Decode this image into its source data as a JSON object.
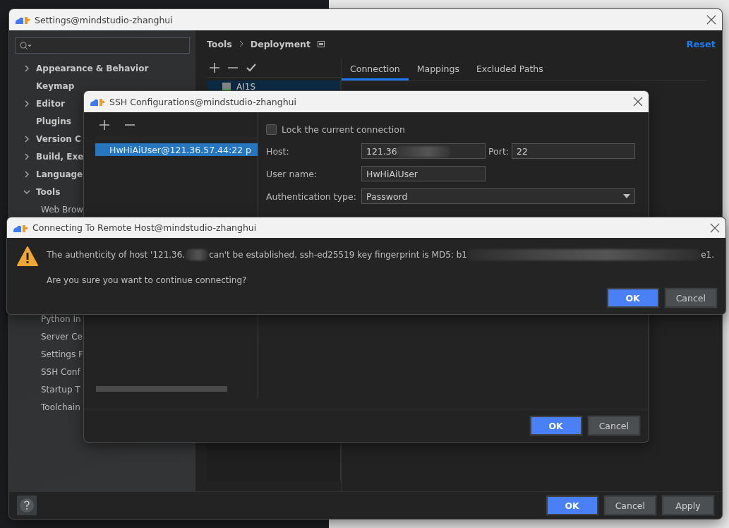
{
  "settings_window": {
    "title": "Settings@mindstudio-zhanghui",
    "sidebar": {
      "items": [
        {
          "label": "Appearance & Behavior",
          "kind": "group",
          "expanded": false
        },
        {
          "label": "Keymap",
          "kind": "leaf"
        },
        {
          "label": "Editor",
          "kind": "group",
          "expanded": false
        },
        {
          "label": "Plugins",
          "kind": "leaf"
        },
        {
          "label": "Version C",
          "kind": "group",
          "expanded": false
        },
        {
          "label": "Build, Exe",
          "kind": "group",
          "expanded": false
        },
        {
          "label": "Language",
          "kind": "group",
          "expanded": false
        },
        {
          "label": "Tools",
          "kind": "group",
          "expanded": true,
          "children": [
            {
              "label": "Web Brow"
            },
            {
              "label": "Python In"
            },
            {
              "label": "Server Ce"
            },
            {
              "label": "Settings F"
            },
            {
              "label": "SSH Conf"
            },
            {
              "label": "Startup T"
            },
            {
              "label": "Toolchain"
            }
          ]
        }
      ]
    },
    "breadcrumb": [
      "Tools",
      "Deployment"
    ],
    "reset_link": "Reset",
    "server_list": {
      "items": [
        {
          "name": "AI1S",
          "selected": true
        }
      ]
    },
    "tabs": [
      {
        "label": "Connection",
        "selected": true
      },
      {
        "label": "Mappings",
        "selected": false
      },
      {
        "label": "Excluded Paths",
        "selected": false
      }
    ],
    "buttons": [
      {
        "label": "OK",
        "primary": true
      },
      {
        "label": "Cancel",
        "primary": false
      },
      {
        "label": "Apply",
        "primary": false
      }
    ]
  },
  "ssh_dialog": {
    "title": "SSH Configurations@mindstudio-zhanghui",
    "configs": [
      {
        "label": "HwHiAiUser@121.36.57.44:22 p",
        "selected": true
      }
    ],
    "lock_connection": {
      "label": "Lock the current connection",
      "checked": false
    },
    "host": {
      "label": "Host:",
      "value": "121.36"
    },
    "port": {
      "label": "Port:",
      "value": "22"
    },
    "user_name": {
      "label": "User name:",
      "value": "HwHiAiUser"
    },
    "auth_type": {
      "label": "Authentication type:",
      "value": "Password"
    },
    "buttons": [
      {
        "label": "OK",
        "primary": true
      },
      {
        "label": "Cancel",
        "primary": false
      }
    ]
  },
  "connect_dialog": {
    "title": "Connecting To Remote Host@mindstudio-zhanghui",
    "message_parts": [
      "The authenticity of host '121.36.",
      "can't be established. ssh-ed25519 key fingerprint is MD5: b1",
      "e1."
    ],
    "question": "Are you sure you want to continue connecting?",
    "buttons": [
      {
        "label": "OK",
        "primary": true
      },
      {
        "label": "Cancel",
        "primary": false
      }
    ]
  }
}
